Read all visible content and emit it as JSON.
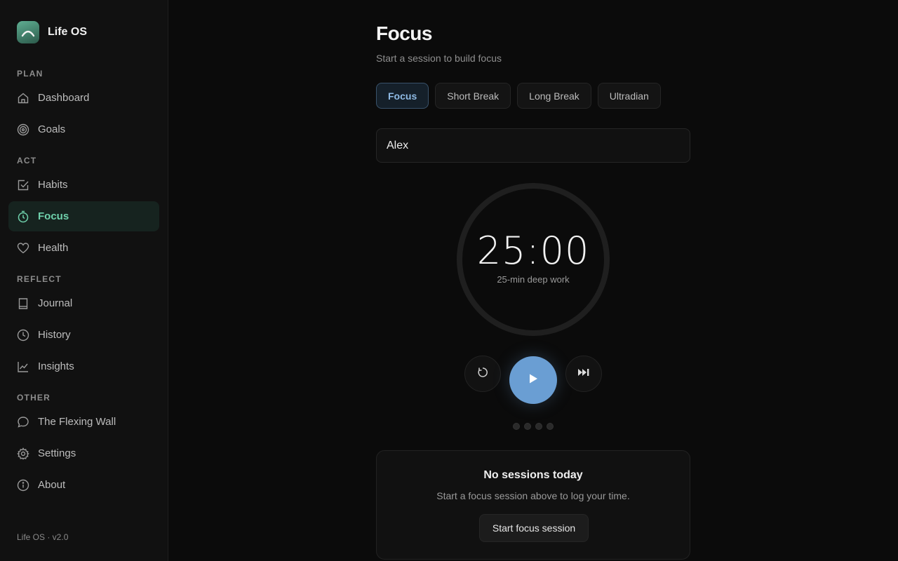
{
  "app": {
    "name": "Life OS",
    "version_label": "Life OS · v2.0"
  },
  "sidebar": {
    "sections": {
      "plan": "PLAN",
      "act": "ACT",
      "reflect": "REFLECT",
      "other": "OTHER"
    },
    "items": [
      {
        "label": "Dashboard",
        "icon": "home-icon"
      },
      {
        "label": "Goals",
        "icon": "target-icon"
      },
      {
        "label": "Habits",
        "icon": "checkbox-icon"
      },
      {
        "label": "Focus",
        "icon": "timer-icon",
        "active": true
      },
      {
        "label": "Health",
        "icon": "heart-icon"
      },
      {
        "label": "Journal",
        "icon": "book-icon"
      },
      {
        "label": "History",
        "icon": "clock-icon"
      },
      {
        "label": "Insights",
        "icon": "chart-line-icon"
      },
      {
        "label": "The Flexing Wall",
        "icon": "chat-bubble-icon"
      },
      {
        "label": "Settings",
        "icon": "gear-icon"
      },
      {
        "label": "About",
        "icon": "info-icon"
      }
    ]
  },
  "main": {
    "title": "Focus",
    "subtitle": "Start a session to build focus",
    "tabs": [
      {
        "label": "Focus",
        "active": true
      },
      {
        "label": "Short Break"
      },
      {
        "label": "Long Break"
      },
      {
        "label": "Ultradian"
      }
    ],
    "task_input": {
      "value": "Alex"
    },
    "timer": {
      "time": "25:00",
      "label": "25-min deep work",
      "progress": 0
    },
    "controls": {
      "reset_icon": "reset-icon",
      "play_icon": "play-icon",
      "skip_icon": "skip-forward-icon"
    },
    "session_dots": 4,
    "sessions_card": {
      "title": "No sessions today",
      "description": "Start a focus session above to log your time.",
      "button_label": "Start focus session"
    }
  },
  "colors": {
    "background": "#0b0b0b",
    "sidebar": "#111111",
    "accent_green": "#6fd1ac",
    "accent_blue": "#6a9ed3"
  }
}
